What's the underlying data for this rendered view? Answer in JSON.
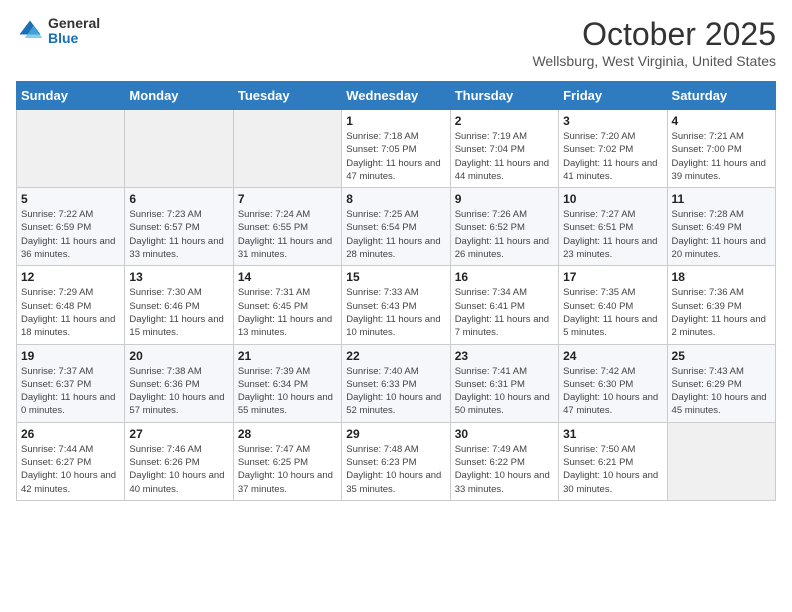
{
  "logo": {
    "general": "General",
    "blue": "Blue"
  },
  "header": {
    "month": "October 2025",
    "location": "Wellsburg, West Virginia, United States"
  },
  "weekdays": [
    "Sunday",
    "Monday",
    "Tuesday",
    "Wednesday",
    "Thursday",
    "Friday",
    "Saturday"
  ],
  "weeks": [
    [
      {
        "day": "",
        "info": ""
      },
      {
        "day": "",
        "info": ""
      },
      {
        "day": "",
        "info": ""
      },
      {
        "day": "1",
        "info": "Sunrise: 7:18 AM\nSunset: 7:05 PM\nDaylight: 11 hours and 47 minutes."
      },
      {
        "day": "2",
        "info": "Sunrise: 7:19 AM\nSunset: 7:04 PM\nDaylight: 11 hours and 44 minutes."
      },
      {
        "day": "3",
        "info": "Sunrise: 7:20 AM\nSunset: 7:02 PM\nDaylight: 11 hours and 41 minutes."
      },
      {
        "day": "4",
        "info": "Sunrise: 7:21 AM\nSunset: 7:00 PM\nDaylight: 11 hours and 39 minutes."
      }
    ],
    [
      {
        "day": "5",
        "info": "Sunrise: 7:22 AM\nSunset: 6:59 PM\nDaylight: 11 hours and 36 minutes."
      },
      {
        "day": "6",
        "info": "Sunrise: 7:23 AM\nSunset: 6:57 PM\nDaylight: 11 hours and 33 minutes."
      },
      {
        "day": "7",
        "info": "Sunrise: 7:24 AM\nSunset: 6:55 PM\nDaylight: 11 hours and 31 minutes."
      },
      {
        "day": "8",
        "info": "Sunrise: 7:25 AM\nSunset: 6:54 PM\nDaylight: 11 hours and 28 minutes."
      },
      {
        "day": "9",
        "info": "Sunrise: 7:26 AM\nSunset: 6:52 PM\nDaylight: 11 hours and 26 minutes."
      },
      {
        "day": "10",
        "info": "Sunrise: 7:27 AM\nSunset: 6:51 PM\nDaylight: 11 hours and 23 minutes."
      },
      {
        "day": "11",
        "info": "Sunrise: 7:28 AM\nSunset: 6:49 PM\nDaylight: 11 hours and 20 minutes."
      }
    ],
    [
      {
        "day": "12",
        "info": "Sunrise: 7:29 AM\nSunset: 6:48 PM\nDaylight: 11 hours and 18 minutes."
      },
      {
        "day": "13",
        "info": "Sunrise: 7:30 AM\nSunset: 6:46 PM\nDaylight: 11 hours and 15 minutes."
      },
      {
        "day": "14",
        "info": "Sunrise: 7:31 AM\nSunset: 6:45 PM\nDaylight: 11 hours and 13 minutes."
      },
      {
        "day": "15",
        "info": "Sunrise: 7:33 AM\nSunset: 6:43 PM\nDaylight: 11 hours and 10 minutes."
      },
      {
        "day": "16",
        "info": "Sunrise: 7:34 AM\nSunset: 6:41 PM\nDaylight: 11 hours and 7 minutes."
      },
      {
        "day": "17",
        "info": "Sunrise: 7:35 AM\nSunset: 6:40 PM\nDaylight: 11 hours and 5 minutes."
      },
      {
        "day": "18",
        "info": "Sunrise: 7:36 AM\nSunset: 6:39 PM\nDaylight: 11 hours and 2 minutes."
      }
    ],
    [
      {
        "day": "19",
        "info": "Sunrise: 7:37 AM\nSunset: 6:37 PM\nDaylight: 11 hours and 0 minutes."
      },
      {
        "day": "20",
        "info": "Sunrise: 7:38 AM\nSunset: 6:36 PM\nDaylight: 10 hours and 57 minutes."
      },
      {
        "day": "21",
        "info": "Sunrise: 7:39 AM\nSunset: 6:34 PM\nDaylight: 10 hours and 55 minutes."
      },
      {
        "day": "22",
        "info": "Sunrise: 7:40 AM\nSunset: 6:33 PM\nDaylight: 10 hours and 52 minutes."
      },
      {
        "day": "23",
        "info": "Sunrise: 7:41 AM\nSunset: 6:31 PM\nDaylight: 10 hours and 50 minutes."
      },
      {
        "day": "24",
        "info": "Sunrise: 7:42 AM\nSunset: 6:30 PM\nDaylight: 10 hours and 47 minutes."
      },
      {
        "day": "25",
        "info": "Sunrise: 7:43 AM\nSunset: 6:29 PM\nDaylight: 10 hours and 45 minutes."
      }
    ],
    [
      {
        "day": "26",
        "info": "Sunrise: 7:44 AM\nSunset: 6:27 PM\nDaylight: 10 hours and 42 minutes."
      },
      {
        "day": "27",
        "info": "Sunrise: 7:46 AM\nSunset: 6:26 PM\nDaylight: 10 hours and 40 minutes."
      },
      {
        "day": "28",
        "info": "Sunrise: 7:47 AM\nSunset: 6:25 PM\nDaylight: 10 hours and 37 minutes."
      },
      {
        "day": "29",
        "info": "Sunrise: 7:48 AM\nSunset: 6:23 PM\nDaylight: 10 hours and 35 minutes."
      },
      {
        "day": "30",
        "info": "Sunrise: 7:49 AM\nSunset: 6:22 PM\nDaylight: 10 hours and 33 minutes."
      },
      {
        "day": "31",
        "info": "Sunrise: 7:50 AM\nSunset: 6:21 PM\nDaylight: 10 hours and 30 minutes."
      },
      {
        "day": "",
        "info": ""
      }
    ]
  ]
}
